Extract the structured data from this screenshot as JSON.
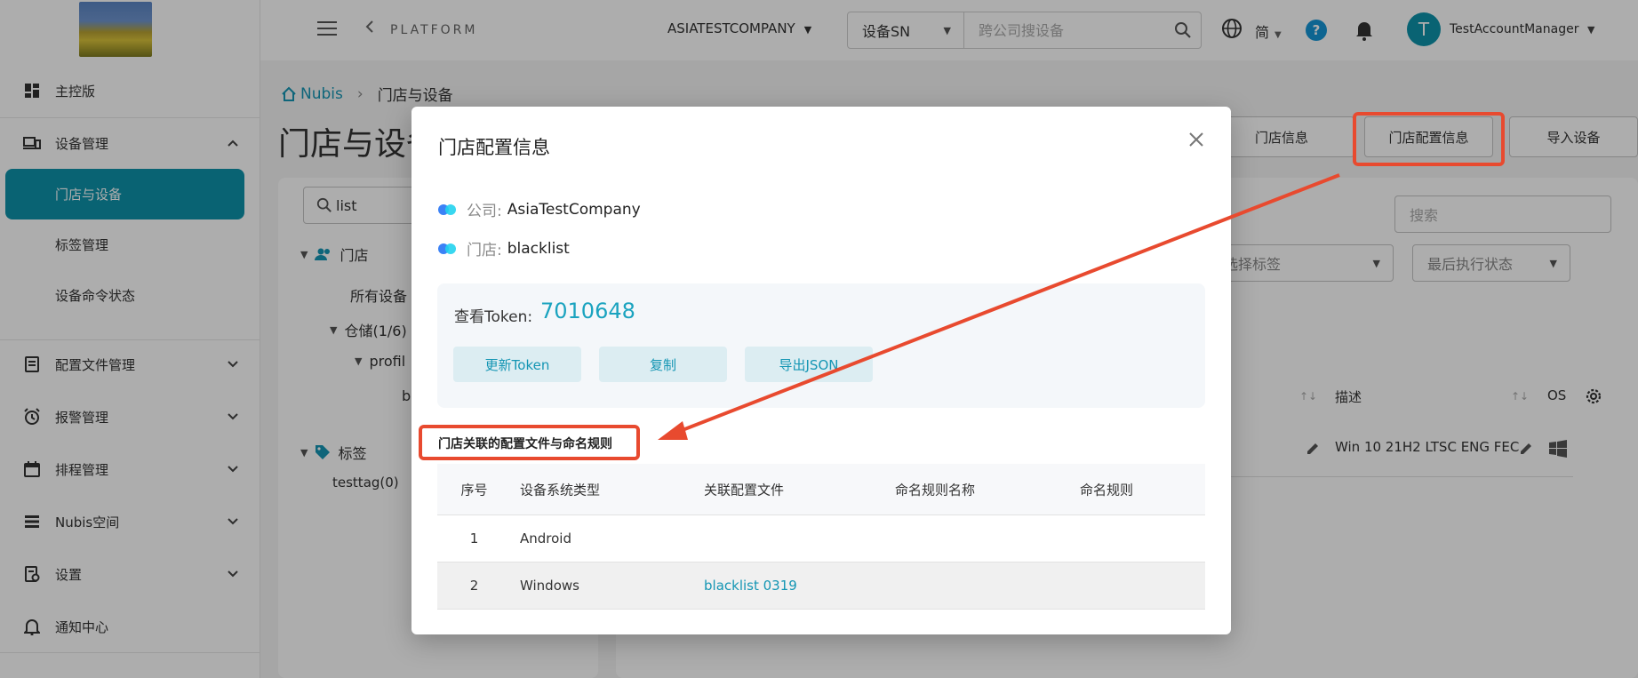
{
  "header": {
    "platform": "PLATFORM",
    "company": "ASIATESTCOMPANY",
    "search_type": "设备SN",
    "search_placeholder": "跨公司搜设备",
    "language": "简",
    "avatar_letter": "T",
    "user_name": "TestAccountManager"
  },
  "sidebar": {
    "items": [
      {
        "label": "主控版"
      },
      {
        "label": "设备管理"
      },
      {
        "label": "门店与设备"
      },
      {
        "label": "标签管理"
      },
      {
        "label": "设备命令状态"
      },
      {
        "label": "配置文件管理"
      },
      {
        "label": "报警管理"
      },
      {
        "label": "排程管理"
      },
      {
        "label": "Nubis空间"
      },
      {
        "label": "设置"
      },
      {
        "label": "通知中心"
      }
    ]
  },
  "main": {
    "breadcrumb": {
      "home": "Nubis",
      "current": "门店与设备"
    },
    "page_title": "门店与设备",
    "buttons": {
      "store_info": "门店信息",
      "store_config_info": "门店配置信息",
      "import_device": "导入设备"
    },
    "left_search": "list",
    "tree": {
      "stores_label": "门店",
      "all_devices": "所有设备",
      "warehouse": "仓储(1/6)",
      "profile": "profil",
      "blacklist": "bl",
      "tags_label": "标签",
      "tag1": "testtag(0)"
    },
    "right": {
      "search_placeholder": "搜索",
      "tag_select": "选择标签",
      "status_select": "最后执行状态",
      "col_desc": "描述",
      "col_os": "OS",
      "row_desc": "Win 10 21H2 LTSC ENG FEC"
    }
  },
  "modal": {
    "title": "门店配置信息",
    "company_label": "公司:",
    "company_value": "AsiaTestCompany",
    "store_label": "门店:",
    "store_value": "blacklist",
    "token_label": "查看Token:",
    "token_value": "7010648",
    "refresh_token": "更新Token",
    "copy": "复制",
    "export_json": "导出JSON",
    "section_title": "门店关联的配置文件与命名规则",
    "table": {
      "headers": [
        "序号",
        "设备系统类型",
        "关联配置文件",
        "命名规则名称",
        "命名规则"
      ],
      "rows": [
        [
          "1",
          "Android",
          "",
          "",
          ""
        ],
        [
          "2",
          "Windows",
          "blacklist 0319",
          "",
          ""
        ]
      ]
    }
  },
  "colors": {
    "accent": "#0e93aa",
    "link": "#1596b4",
    "highlight": "#e84a2f"
  }
}
